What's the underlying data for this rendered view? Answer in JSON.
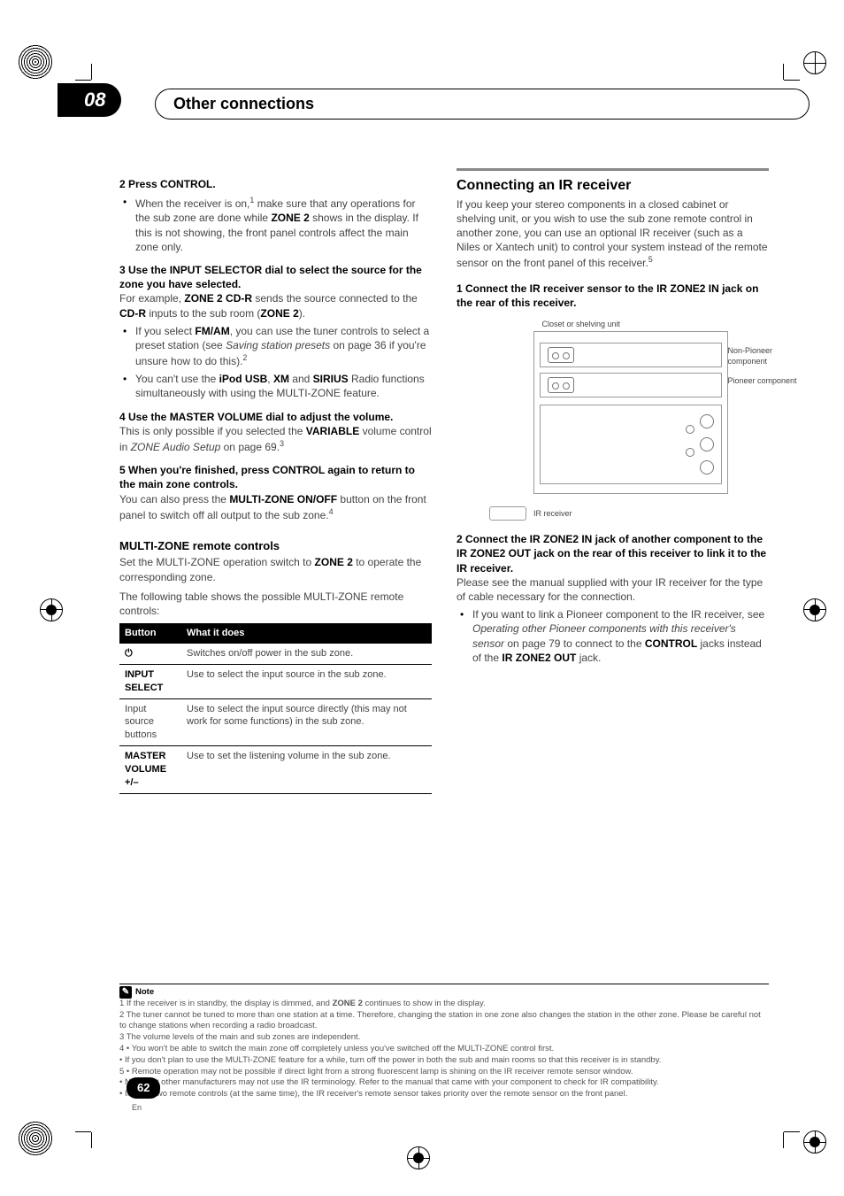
{
  "chapter": {
    "number": "08",
    "title": "Other connections"
  },
  "left": {
    "s2_head": "2   Press CONTROL.",
    "s2_bullet": "When the receiver is on,",
    "s2_sup": "1",
    "s2_rest": " make sure that any operations for the sub zone are done while ",
    "s2_bold1": "ZONE 2",
    "s2_rest2": " shows in the display. If this is not showing, the front panel controls affect the main zone only.",
    "s3_head": "3   Use the INPUT SELECTOR dial to select the source for the zone you have selected.",
    "s3_p1a": "For example, ",
    "s3_b1": "ZONE 2 CD-R",
    "s3_p1b": " sends the source connected to the ",
    "s3_b2": "CD-R",
    "s3_p1c": " inputs to the sub room (",
    "s3_b3": "ZONE 2",
    "s3_p1d": ").",
    "s3_bul1a": "If you select ",
    "s3_bul1_b1": "FM/AM",
    "s3_bul1b": ", you can use the tuner controls to select a preset station (see ",
    "s3_bul1_i": "Saving station presets",
    "s3_bul1c": " on page 36 if you're unsure how to do this).",
    "s3_bul1_sup": "2",
    "s3_bul2a": "You can't use the ",
    "s3_bul2_b1": "iPod USB",
    "s3_bul2b": ", ",
    "s3_bul2_b2": "XM",
    "s3_bul2c": " and ",
    "s3_bul2_b3": "SIRIUS",
    "s3_bul2d": " Radio functions simultaneously with using the MULTI-ZONE feature.",
    "s4_head": "4   Use the MASTER VOLUME dial to adjust the volume.",
    "s4_p1a": "This is only possible if you selected the ",
    "s4_b1": "VARIABLE",
    "s4_p1b": " volume control in ",
    "s4_i1": "ZONE Audio Setup",
    "s4_p1c": " on page 69.",
    "s4_sup": "3",
    "s5_head": "5   When you're finished, press CONTROL again to return to the main zone controls.",
    "s5_p1a": "You can also press the ",
    "s5_b1": "MULTI-ZONE ON/OFF",
    "s5_p1b": " button on the front panel to switch off all output to the sub zone.",
    "s5_sup": "4",
    "mz_head": "MULTI-ZONE remote controls",
    "mz_p1a": "Set the MULTI-ZONE operation switch to ",
    "mz_b1": "ZONE 2",
    "mz_p1b": " to operate the corresponding zone.",
    "mz_p2": "The following table shows the possible MULTI-ZONE remote controls:",
    "table": {
      "h1": "Button",
      "h2": "What it does",
      "r1c1": "⏻",
      "r1c2": "Switches on/off power in the sub zone.",
      "r2c1": "INPUT SELECT",
      "r2c2": "Use to select the input source in the sub zone.",
      "r3c1": "Input source buttons",
      "r3c2": "Use to select the input source directly (this may not work for some functions) in the sub zone.",
      "r4c1": "MASTER VOLUME +/–",
      "r4c2": "Use to set the listening volume in the sub zone."
    }
  },
  "right": {
    "sec_title": "Connecting an IR receiver",
    "p1": "If you keep your stereo components in a closed cabinet or shelving unit, or you wish to use the sub zone remote control in another zone, you can use an optional IR receiver (such as a Niles or Xantech unit) to control your system instead of the remote sensor on the front panel of this receiver.",
    "p1_sup": "5",
    "s1_head": "1   Connect the IR receiver sensor to the IR ZONE2 IN jack on the rear of this receiver.",
    "diagram": {
      "shelf": "Closet or shelving unit",
      "comp1": "Non-Pioneer component",
      "comp2": "Pioneer component",
      "ir": "IR receiver"
    },
    "s2_head": "2   Connect the IR ZONE2 IN jack of another component to the IR ZONE2 OUT jack on the rear of this receiver to link it to the IR receiver.",
    "s2_p1": "Please see the manual supplied with your IR receiver for the type of cable necessary for the connection.",
    "s2_bul_a": "If you want to link a Pioneer component to the IR receiver, see ",
    "s2_bul_i": "Operating other Pioneer components with this receiver's sensor",
    "s2_bul_b": " on page 79 to connect to the ",
    "s2_bul_bold1": "CONTROL",
    "s2_bul_c": " jacks instead of the ",
    "s2_bul_bold2": "IR ZONE2 OUT",
    "s2_bul_d": " jack."
  },
  "notes": {
    "head": "Note",
    "n1a": "1 If the receiver is in standby, the display is dimmed, and ",
    "n1b": "ZONE 2",
    "n1c": " continues to show in the display.",
    "n2": "2 The tuner cannot be tuned to more than one station at a time. Therefore, changing the station in one zone also changes the station in the other zone. Please be careful not to change stations when recording a radio broadcast.",
    "n3": "3 The volume levels of the main and sub zones are independent.",
    "n4a": "4 • You won't be able to switch the main zone off completely unless you've switched off the MULTI-ZONE control first.",
    "n4b": "   • If you don't plan to use the MULTI-ZONE feature for a while, turn off the power in both the sub and main rooms so that this receiver is in standby.",
    "n5a": "5 • Remote operation may not be possible if direct light from a strong fluorescent lamp is shining on the IR receiver remote sensor window.",
    "n5b": "   • Note that other manufacturers may not use the IR terminology. Refer to the manual that came with your component to check for IR compatibility.",
    "n5c": "   • If using two remote controls (at the same time), the IR receiver's remote sensor takes priority over the remote sensor on the front panel."
  },
  "page": {
    "num": "62",
    "lang": "En"
  }
}
